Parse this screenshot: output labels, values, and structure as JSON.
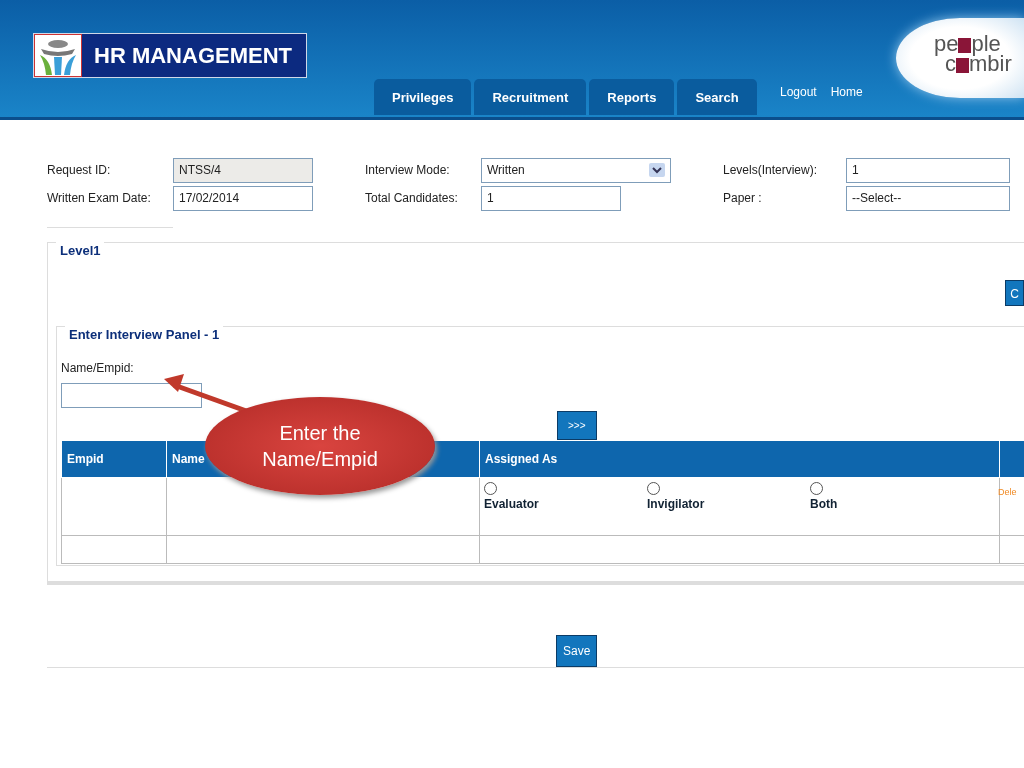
{
  "header": {
    "app_title": "HR MANAGEMENT",
    "tabs": [
      {
        "label": "Privileges",
        "selected": false
      },
      {
        "label": "Recruitment",
        "selected": false
      },
      {
        "label": "Reports",
        "selected": false
      },
      {
        "label": "Search",
        "selected": false
      }
    ],
    "links": [
      "Logout",
      "Home"
    ],
    "brand": {
      "line1_start": "pe",
      "line1_end": "ple",
      "line2_start": "c",
      "line2_end": "mbir"
    }
  },
  "form": {
    "fields": [
      {
        "label": "Request ID:",
        "value": "NTSS/4",
        "kind": "readonly"
      },
      {
        "label": "Interview Mode:",
        "value": "Written",
        "kind": "select"
      },
      {
        "label": "Levels(Interview):",
        "value": "1",
        "kind": "text"
      },
      {
        "label": "Written Exam Date:",
        "value": "17/02/2014",
        "kind": "text"
      },
      {
        "label": "Total Candidates:",
        "value": "1",
        "kind": "text"
      },
      {
        "label": "Paper :",
        "value": "--Select--",
        "kind": "text"
      }
    ]
  },
  "level": {
    "title": "Level1",
    "button": "C",
    "panel": {
      "title": "Enter Interview Panel - 1",
      "field_label": "Name/Empid:",
      "add_button": ">>>",
      "table": {
        "columns": [
          "Empid",
          "Name",
          "Assigned As"
        ],
        "rows": [
          {
            "options": [
              {
                "label": "Evaluator",
                "selected": false
              },
              {
                "label": "Invigilator",
                "selected": false
              },
              {
                "label": "Both",
                "selected": false
              }
            ],
            "action": "Dele"
          },
          {
            "options": []
          }
        ]
      }
    }
  },
  "save_button": "Save",
  "callout": {
    "text": "Enter the Name/Empid"
  }
}
